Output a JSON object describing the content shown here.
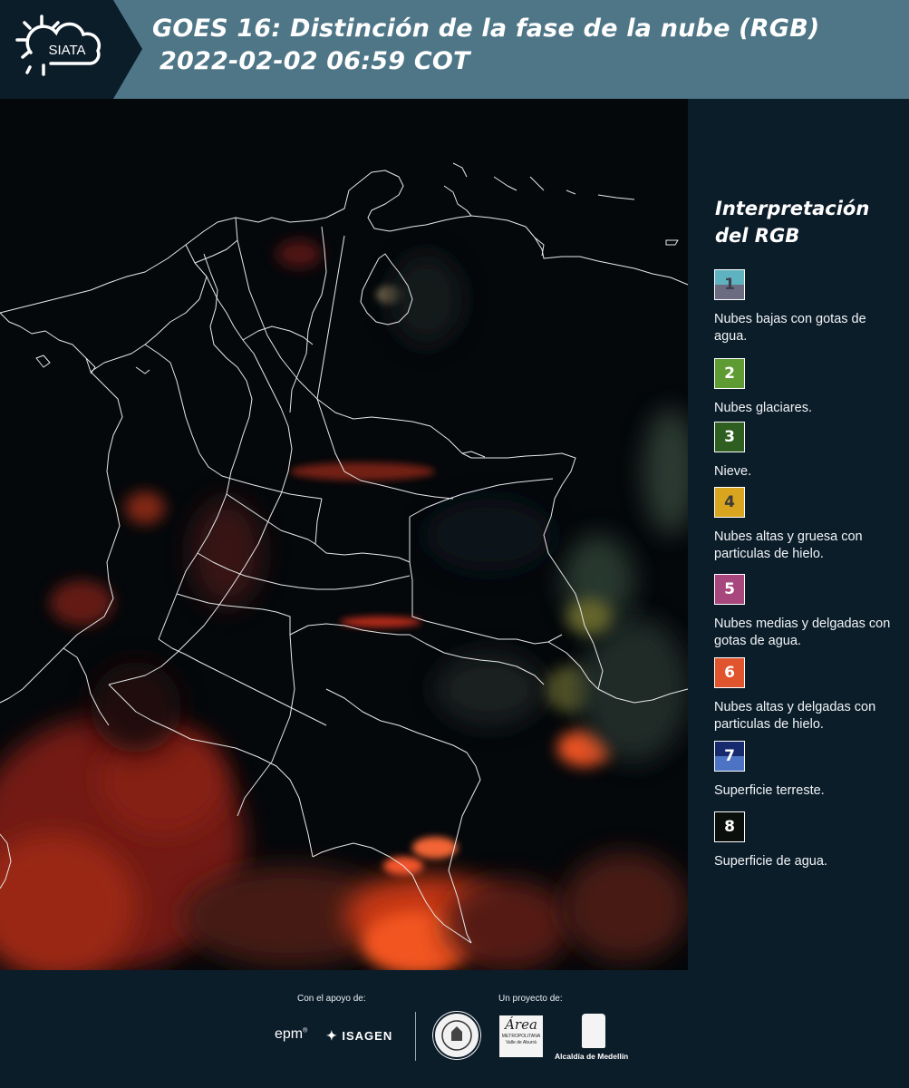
{
  "header": {
    "logo_text": "SIATA",
    "title_line1": "GOES 16: Distinción de la fase de la nube (RGB)",
    "title_line2": "2022-02-02 06:59 COT"
  },
  "legend": {
    "title_line1": "Interpretación",
    "title_line2": "del RGB",
    "items": [
      {
        "num": "1",
        "text": "Nubes bajas con gotas de agua.",
        "color_top": "#5fb3c0",
        "color_bottom": "#6b6b82",
        "num_color": "#3a3f4a"
      },
      {
        "num": "2",
        "text": "Nubes glaciares.",
        "color_top": "#5e9c33",
        "color_bottom": "#5e9c33",
        "num_color": "#ffffff"
      },
      {
        "num": "3",
        "text": "Nieve.",
        "color_top": "#2e5e20",
        "color_bottom": "#2e5e20",
        "num_color": "#ffffff"
      },
      {
        "num": "4",
        "text": "Nubes altas y gruesa con particulas de hielo.",
        "color_top": "#d9a51e",
        "color_bottom": "#d9a51e",
        "num_color": "#3a3a3a"
      },
      {
        "num": "5",
        "text": "Nubes medias y delgadas con gotas de agua.",
        "color_top": "#a8467e",
        "color_bottom": "#a8467e",
        "num_color": "#ffffff"
      },
      {
        "num": "6",
        "text": "Nubes altas y delgadas con particulas de hielo.",
        "color_top": "#e0542e",
        "color_bottom": "#e0542e",
        "num_color": "#ffffff"
      },
      {
        "num": "7",
        "text": "Superficie terreste.",
        "color_top": "#172a6e",
        "color_bottom": "#4d74c4",
        "num_color": "#ffffff"
      },
      {
        "num": "8",
        "text": "Superficie de agua.",
        "color_top": "#0b0f0b",
        "color_bottom": "#0b0f0b",
        "num_color": "#ffffff"
      }
    ]
  },
  "footer": {
    "support_label": "Con el apoyo de:",
    "project_label": "Un proyecto de:",
    "epm": "epm",
    "isagen": "ISAGEN",
    "amva_name": "Área",
    "amva_sub1": "METROPOLITANA",
    "amva_sub2": "Valle de Aburrá",
    "alcaldia": "Alcaldía de Medellín"
  }
}
